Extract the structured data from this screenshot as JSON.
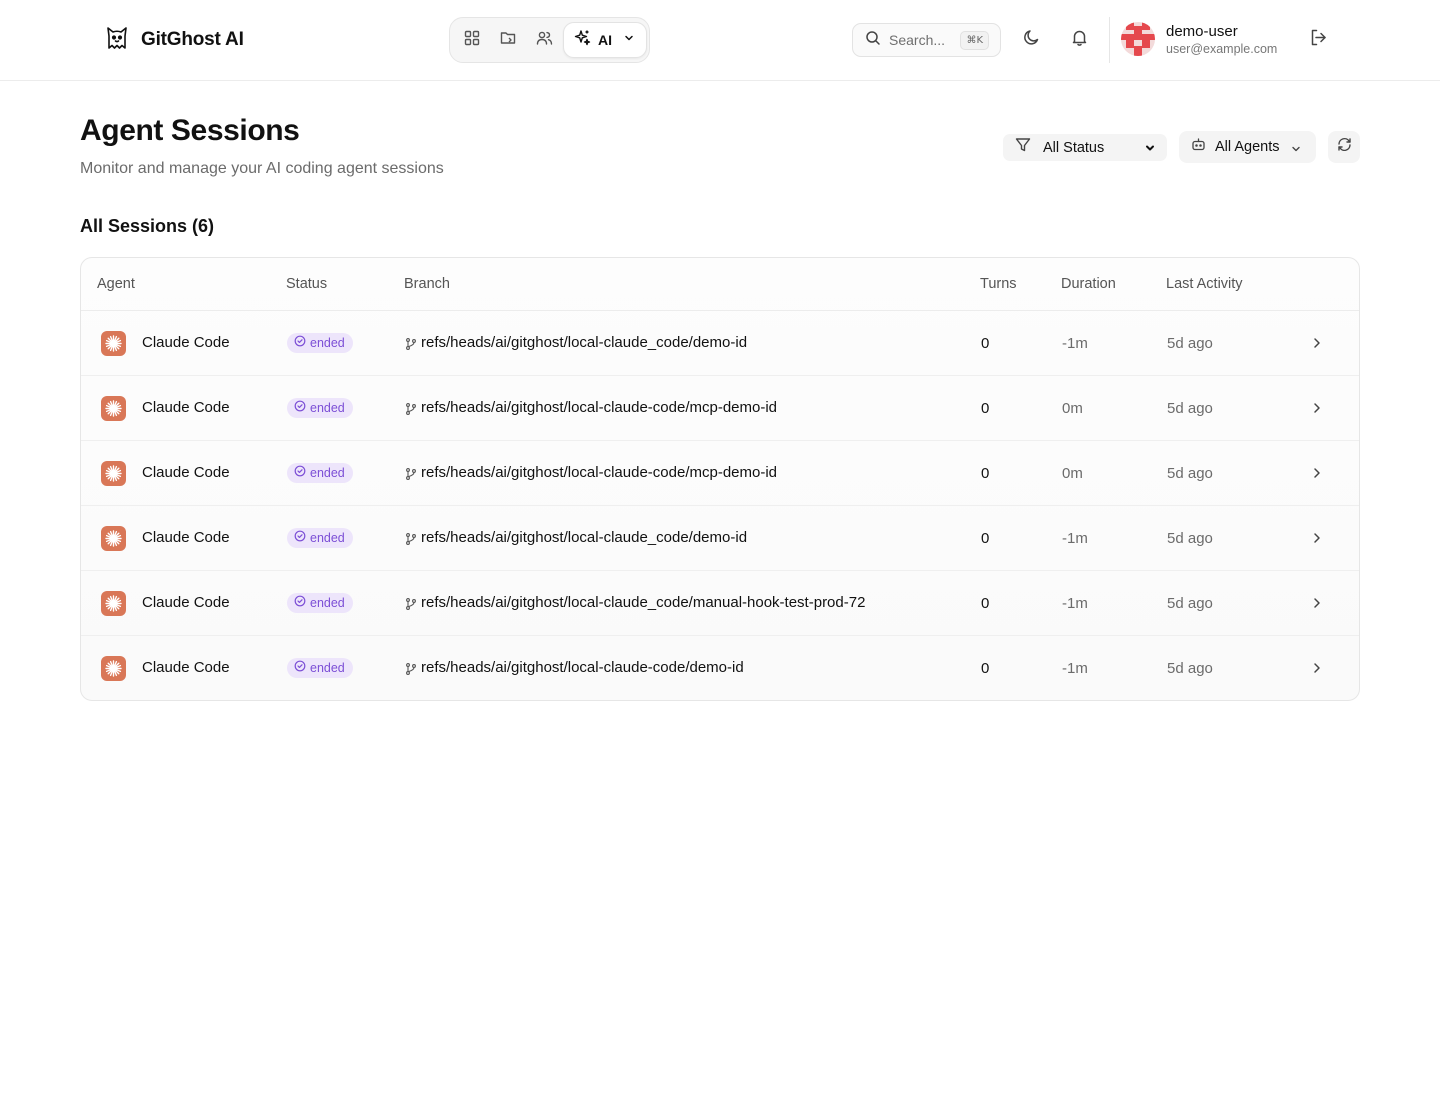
{
  "app": {
    "name": "GitGhost AI",
    "logo_icon": "ghost-cat-icon"
  },
  "nav": {
    "items": [
      {
        "name": "dashboard-icon"
      },
      {
        "name": "repository-icon"
      },
      {
        "name": "team-icon"
      }
    ],
    "ai_label": "AI"
  },
  "search": {
    "placeholder": "Search...",
    "shortcut": "⌘K"
  },
  "user": {
    "name": "demo-user",
    "email": "user@example.com"
  },
  "page": {
    "title": "Agent Sessions",
    "subtitle": "Monitor and manage your AI coding agent sessions"
  },
  "filters": {
    "status": "All Status",
    "agents": "All Agents"
  },
  "section": {
    "title": "All Sessions (6)"
  },
  "table": {
    "headers": {
      "agent": "Agent",
      "status": "Status",
      "branch": "Branch",
      "turns": "Turns",
      "duration": "Duration",
      "last_activity": "Last Activity"
    },
    "rows": [
      {
        "agent": "Claude Code",
        "status": "ended",
        "branch": "refs/heads/ai/gitghost/local-claude_code/demo-id",
        "turns": "0",
        "duration": "-1m",
        "last_activity": "5d ago"
      },
      {
        "agent": "Claude Code",
        "status": "ended",
        "branch": "refs/heads/ai/gitghost/local-claude-code/mcp-demo-id",
        "turns": "0",
        "duration": "0m",
        "last_activity": "5d ago"
      },
      {
        "agent": "Claude Code",
        "status": "ended",
        "branch": "refs/heads/ai/gitghost/local-claude-code/mcp-demo-id",
        "turns": "0",
        "duration": "0m",
        "last_activity": "5d ago"
      },
      {
        "agent": "Claude Code",
        "status": "ended",
        "branch": "refs/heads/ai/gitghost/local-claude_code/demo-id",
        "turns": "0",
        "duration": "-1m",
        "last_activity": "5d ago"
      },
      {
        "agent": "Claude Code",
        "status": "ended",
        "branch": "refs/heads/ai/gitghost/local-claude_code/manual-hook-test-prod-72",
        "turns": "0",
        "duration": "-1m",
        "last_activity": "5d ago"
      },
      {
        "agent": "Claude Code",
        "status": "ended",
        "branch": "refs/heads/ai/gitghost/local-claude-code/demo-id",
        "turns": "0",
        "duration": "-1m",
        "last_activity": "5d ago"
      }
    ]
  },
  "colors": {
    "accent_agent": "#d97757",
    "badge_bg": "#ede5fb",
    "badge_text": "#7c4fd6",
    "avatar": "#e5484d"
  }
}
